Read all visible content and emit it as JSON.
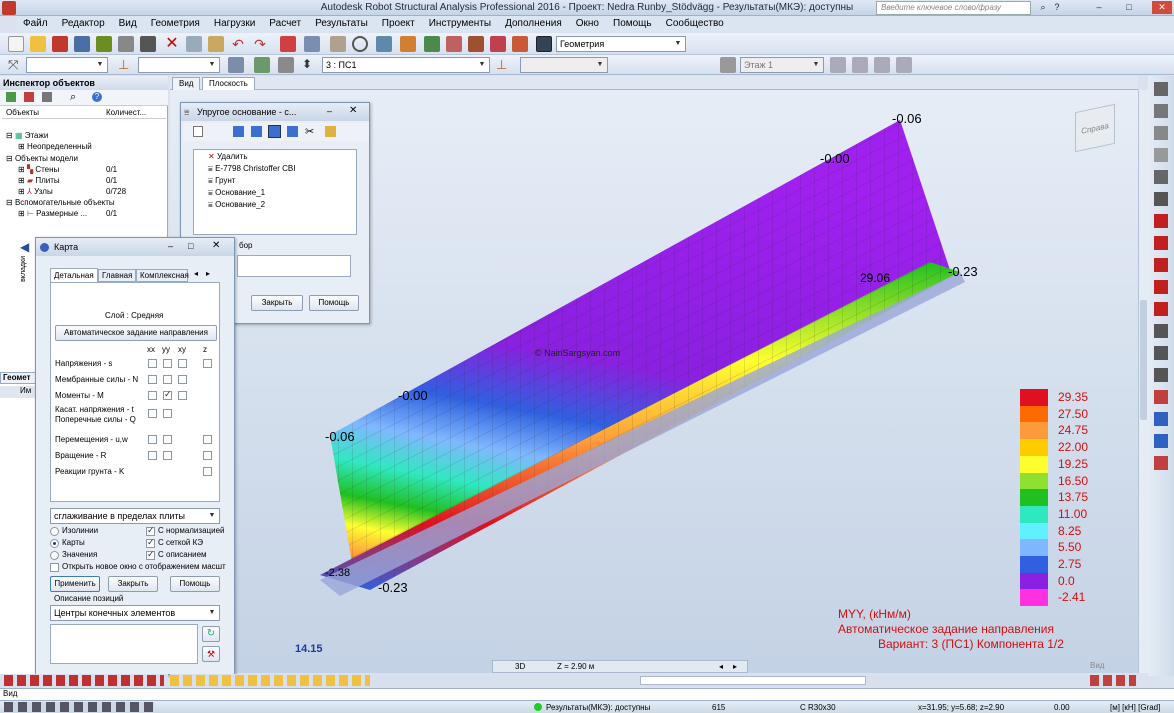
{
  "title": "Autodesk Robot Structural Analysis Professional 2016 - Проект: Nedra Runby_Stödvägg - Результаты(МКЭ): доступны",
  "search_placeholder": "Введите ключевое слово/фразу",
  "menu": [
    "Файл",
    "Редактор",
    "Вид",
    "Геометрия",
    "Нагрузки",
    "Расчет",
    "Результаты",
    "Проект",
    "Инструменты",
    "Дополнения",
    "Окно",
    "Помощь",
    "Сообщество"
  ],
  "toolbar": {
    "geometry_combo": "Геометрия",
    "case_combo": "3 : ПС1",
    "floor_combo": "Этаж 1"
  },
  "inspector": {
    "title": "Инспектор объектов",
    "col_objects": "Объекты",
    "col_count": "Количест...",
    "side_tab": "вкладки",
    "geom_tab": "Геомет",
    "tree": [
      {
        "label": "Этажи",
        "count": ""
      },
      {
        "label": "Неопределенный",
        "count": ""
      },
      {
        "label": "Объекты модели",
        "count": ""
      },
      {
        "label": "Стены",
        "count": "0/1"
      },
      {
        "label": "Плиты",
        "count": "0/1"
      },
      {
        "label": "Узлы",
        "count": "0/728"
      },
      {
        "label": "Вспомогательные объекты",
        "count": ""
      },
      {
        "label": "Размерные ...",
        "count": "0/1"
      }
    ],
    "bottom_col": "Им"
  },
  "view_tabs": [
    "Вид",
    "Плоскость"
  ],
  "dialog_base": {
    "title": "Упругое основание - с...",
    "items": [
      "Удалить",
      "E-7798 Christoffer CBI",
      "Грунт",
      "Основание_1",
      "Основание_2"
    ],
    "label": "бор",
    "btn_close": "Закрыть",
    "btn_help": "Помощь"
  },
  "dialog_map": {
    "title": "Карта",
    "tabs": [
      "Детальная",
      "Главная",
      "Комплексная"
    ],
    "layer": "Слой : Средняя",
    "auto_dir": "Автоматическое задание направления",
    "cols": [
      "xx",
      "yy",
      "xy",
      "z"
    ],
    "rows": [
      "Напряжения - s",
      "Мембранные силы - N",
      "Моменты - M",
      "Касат. напряжения - t",
      "Поперечные силы - Q",
      "Перемещения - u,w",
      "Вращение - R",
      "Реакции грунта - K"
    ],
    "smoothing": "сглаживание в пределах плиты",
    "opt_isolines": "Изолинии",
    "opt_maps": "Карты",
    "opt_values": "Значения",
    "opt_norm": "С нормализацией",
    "opt_mesh": "С сеткой КЭ",
    "opt_desc": "С описанием",
    "open_new": "Открыть новое окно с отображением масшт",
    "btn_apply": "Применить",
    "btn_close": "Закрыть",
    "btn_help": "Помощь",
    "pos_desc": "Описание позиций",
    "pos_value": "Центры конечных элементов"
  },
  "legend": {
    "values": [
      "29.35",
      "27.50",
      "24.75",
      "22.00",
      "19.25",
      "16.50",
      "13.75",
      "11.00",
      "8.25",
      "5.50",
      "2.75",
      "0.0",
      "-2.41"
    ],
    "colors": [
      "#e01020",
      "#ff6a00",
      "#ff9a3a",
      "#ffcc00",
      "#ffff30",
      "#90e030",
      "#20c020",
      "#30e8c0",
      "#60f0ff",
      "#80b8ff",
      "#3060e0",
      "#8a20e0",
      "#ff30e0"
    ]
  },
  "caption": {
    "line1": "MYY, (кНм/м)",
    "line2": "Автоматическое задание направления",
    "line3": "Вариант: 3 (ПС1) Компонента 1/2"
  },
  "view_labels": {
    "scale": "14.15",
    "mode": "3D",
    "z": "Z = 2.90 м",
    "watermark": "© NairiSargsyan.com",
    "cube": "Справа",
    "view_btn": "Вид",
    "top_vals": [
      "-0.06",
      "-0.00",
      "-0.00",
      "-0.06",
      "-0.23",
      "-0.23",
      "29.06",
      "-2.38"
    ]
  },
  "status": {
    "results": "Результаты(МКЭ): доступны",
    "num": "615",
    "section": "C R30x30",
    "coords": "x=31.95; y=5.68; z=2.90",
    "zero": "0.00",
    "units": "[м] [кН] [Grad]"
  },
  "cmd": "Вид"
}
